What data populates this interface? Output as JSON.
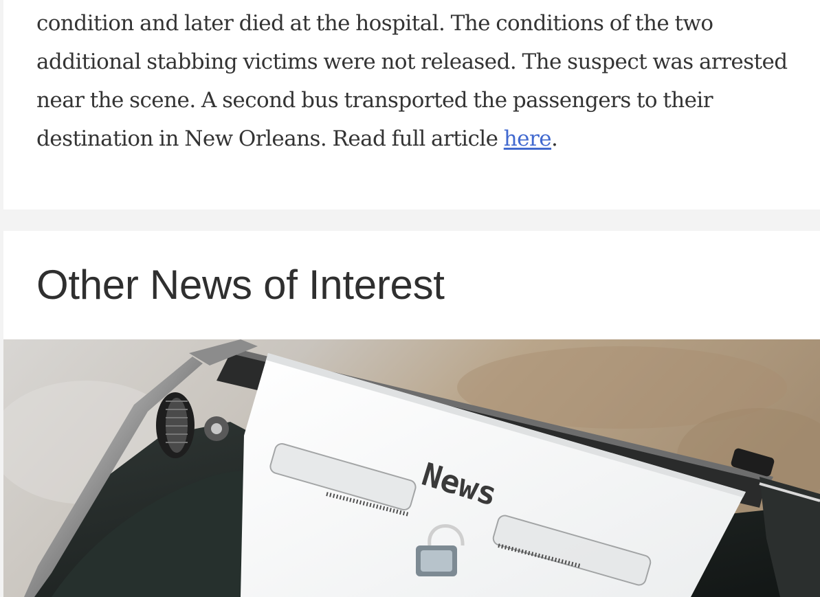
{
  "article": {
    "lines": [
      "condition and later died at the hospital. The conditions of the two",
      "additional stabbing victims were not released. The suspect was arrested",
      "near the scene. A second bus transported the passengers to their"
    ],
    "last_line_prefix": "destination in New Orleans. Read full article ",
    "link_text": "here",
    "last_line_suffix": "."
  },
  "other_news": {
    "title": "Other News of Interest",
    "image": {
      "subject": "typewriter with paper",
      "paper_text": "News"
    }
  },
  "colors": {
    "page_background": "#f3f3f3",
    "card_background": "#ffffff",
    "body_text": "#333333",
    "link": "#4169cf",
    "heading": "#2f2f2f"
  }
}
